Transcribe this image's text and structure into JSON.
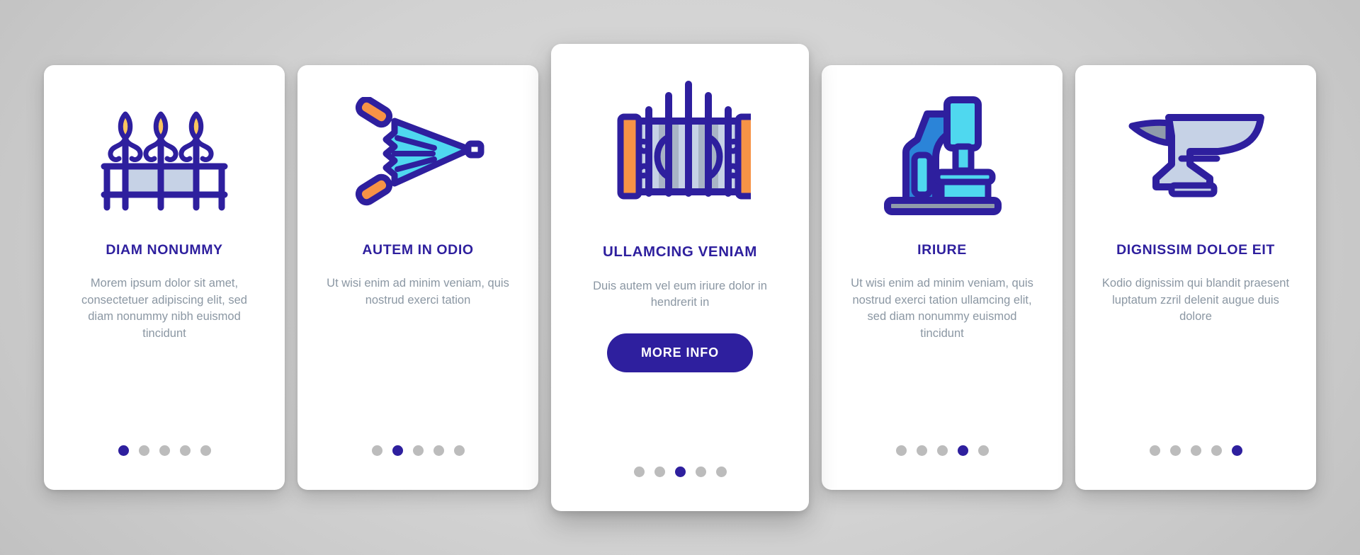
{
  "theme": {
    "accent": "#2e1f9e",
    "body_text": "#8b97a3",
    "dot_inactive": "#bcbcbc",
    "card_bg": "#ffffff",
    "page_bg": "#d4d4d4",
    "icon_cyan": "#4fd8ef",
    "icon_blue": "#2b84d8",
    "icon_orange": "#f79346",
    "icon_lavender": "#c6d2e6",
    "icon_gray": "#8f9bab",
    "icon_yellow": "#fbc55f"
  },
  "cards": [
    {
      "icon_name": "ornamental-fence-icon",
      "title": "DIAM NONUMMY",
      "body": "Morem ipsum dolor sit amet, consectetuer adipiscing elit, sed diam nonummy nibh euismod tincidunt",
      "featured": false,
      "button": null,
      "dots": {
        "count": 5,
        "active_index": 0
      }
    },
    {
      "icon_name": "bellows-icon",
      "title": "AUTEM IN ODIO",
      "body": "Ut wisi enim ad minim veniam, quis nostrud exerci tation",
      "featured": false,
      "button": null,
      "dots": {
        "count": 5,
        "active_index": 1
      }
    },
    {
      "icon_name": "wrought-iron-gate-icon",
      "title": "ULLAMCING VENIAM",
      "body": "Duis autem vel eum iriure dolor in hendrerit in",
      "featured": true,
      "button": "MORE INFO",
      "dots": {
        "count": 5,
        "active_index": 2
      }
    },
    {
      "icon_name": "microscope-icon",
      "title": "IRIURE",
      "body": "Ut wisi enim ad minim veniam, quis nostrud exerci tation ullamcing elit, sed diam nonummy euismod tincidunt",
      "featured": false,
      "button": null,
      "dots": {
        "count": 5,
        "active_index": 3
      }
    },
    {
      "icon_name": "anvil-icon",
      "title": "DIGNISSIM DOLOE EIT",
      "body": "Kodio dignissim qui blandit praesent luptatum zzril delenit augue duis dolore",
      "featured": false,
      "button": null,
      "dots": {
        "count": 5,
        "active_index": 4
      }
    }
  ]
}
